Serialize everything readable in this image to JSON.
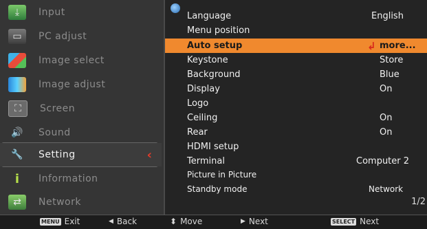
{
  "left_menu": {
    "items": [
      {
        "label": "Input",
        "icon": "input-icon"
      },
      {
        "label": "PC adjust",
        "icon": "pc-adjust-icon"
      },
      {
        "label": "Image select",
        "icon": "image-select-icon"
      },
      {
        "label": "Image adjust",
        "icon": "image-adjust-icon"
      },
      {
        "label": "Screen",
        "icon": "screen-icon"
      },
      {
        "label": "Sound",
        "icon": "sound-icon"
      },
      {
        "label": "Setting",
        "icon": "setting-icon"
      },
      {
        "label": "Information",
        "icon": "information-icon"
      },
      {
        "label": "Network",
        "icon": "network-icon"
      }
    ],
    "active_arrow": "‹"
  },
  "settings": {
    "rows": [
      {
        "name": "Language",
        "value": "English"
      },
      {
        "name": "Menu position",
        "value": ""
      },
      {
        "name": "Auto setup",
        "value": "more..."
      },
      {
        "name": "Keystone",
        "value": "Store"
      },
      {
        "name": "Background",
        "value": "Blue"
      },
      {
        "name": "Display",
        "value": "On"
      },
      {
        "name": "Logo",
        "value": ""
      },
      {
        "name": "Ceiling",
        "value": "On"
      },
      {
        "name": "Rear",
        "value": "On"
      },
      {
        "name": "HDMI setup",
        "value": ""
      },
      {
        "name": "Terminal",
        "value": "Computer 2"
      },
      {
        "name": "Picture in Picture",
        "value": ""
      },
      {
        "name": "Standby mode",
        "value": "Network"
      }
    ],
    "page": "1/2",
    "highlight_color": "#f0892e"
  },
  "bottom_bar": {
    "exit_key": "MENU",
    "exit": "Exit",
    "back_arrow": "◀",
    "back": "Back",
    "move_arrow": "⬍",
    "move": "Move",
    "next_arrow": "▶",
    "next": "Next",
    "select_key": "SELECT",
    "select_next": "Next"
  }
}
